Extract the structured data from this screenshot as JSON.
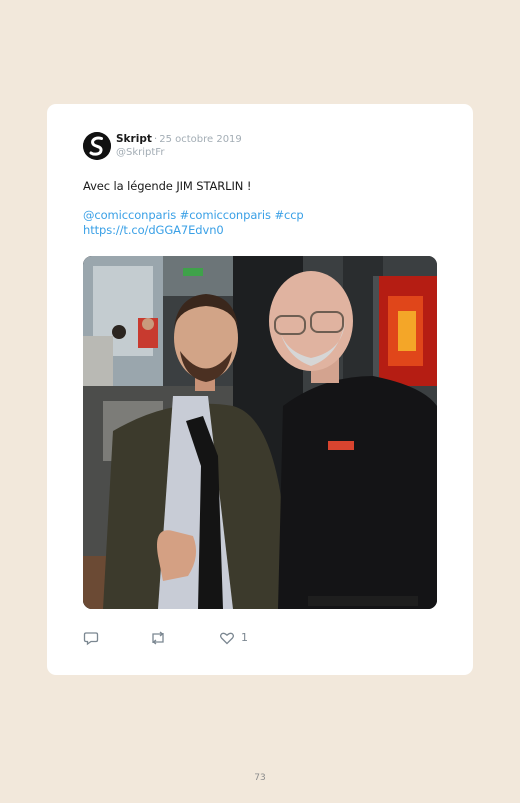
{
  "tweet": {
    "author_name": "Skript",
    "separator": "·",
    "date": "25 octobre 2019",
    "handle": "@SkriptFr",
    "text": "Avec la légende JIM STARLIN !",
    "links": [
      "@comicconparis",
      "#comicconparis",
      "#ccp"
    ],
    "url": "https://t.co/dGGA7Edvn0",
    "photo_description_icon": "photo",
    "like_count": "1",
    "colors": {
      "link": "#3aa0e6",
      "muted": "#a3adb5",
      "page_background": "#f2e8db"
    }
  },
  "page": {
    "number": "73"
  }
}
